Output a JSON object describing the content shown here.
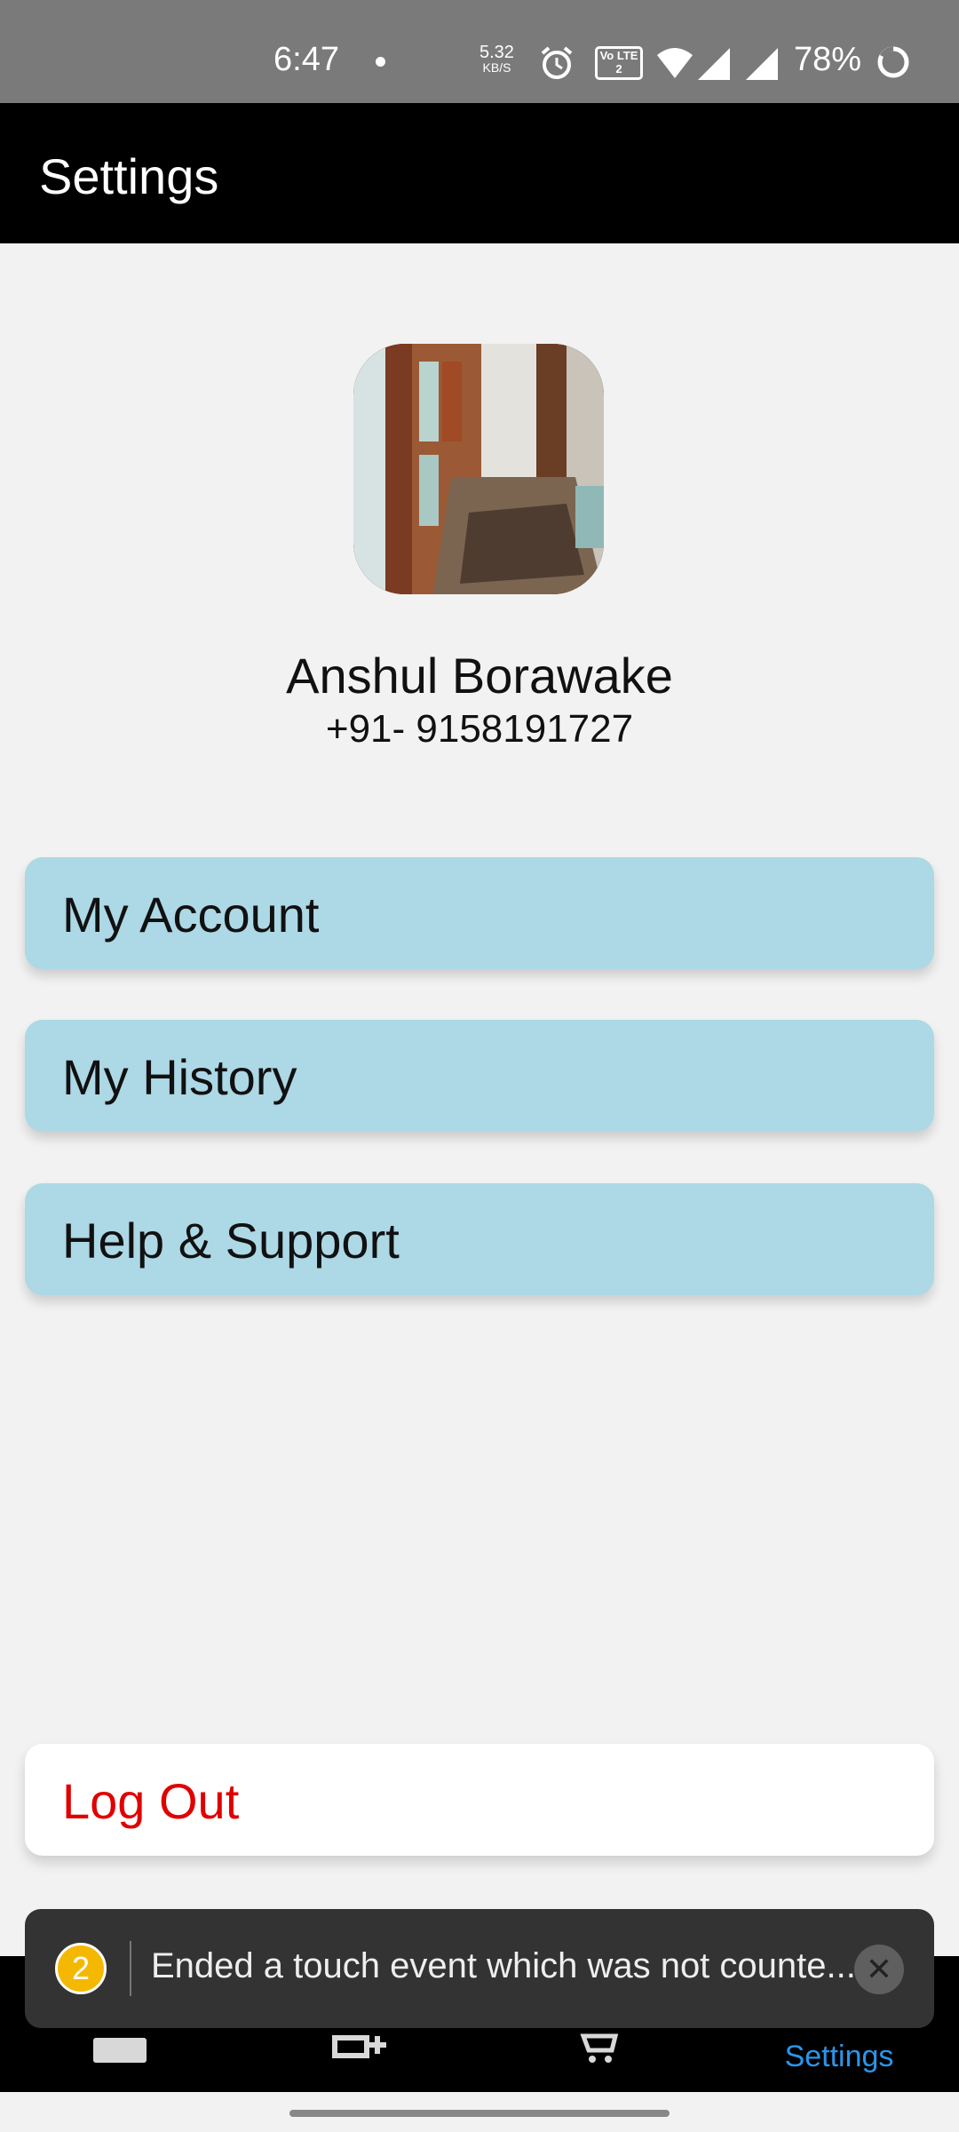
{
  "status_bar": {
    "time": "6:47",
    "speed_value": "5.32",
    "speed_unit": "KB/S",
    "volte_label": "Vo LTE 2",
    "battery": "78%",
    "icons": [
      "alarm-icon",
      "volte-icon",
      "wifi-icon",
      "signal-icon",
      "signal-icon",
      "battery-saver-icon"
    ]
  },
  "header": {
    "title": "Settings"
  },
  "profile": {
    "name": "Anshul Borawake",
    "phone": "+91- 9158191727"
  },
  "menu": {
    "items": [
      {
        "label": "My Account"
      },
      {
        "label": "My History"
      },
      {
        "label": "Help & Support"
      }
    ],
    "logout_label": "Log Out"
  },
  "bottom_nav": {
    "items": [
      {
        "icon": "home-icon",
        "label": ""
      },
      {
        "icon": "add-grid-icon",
        "label": ""
      },
      {
        "icon": "cart-icon",
        "label": ""
      },
      {
        "icon": "settings-icon",
        "label": "Settings",
        "active": true
      }
    ]
  },
  "toast": {
    "badge": "2",
    "message": "Ended a touch event which was not counte..."
  },
  "colors": {
    "menu_card": "#add8e6",
    "logout_text": "#e00000",
    "active_nav": "#2b95e9",
    "app_bar": "#000000"
  }
}
